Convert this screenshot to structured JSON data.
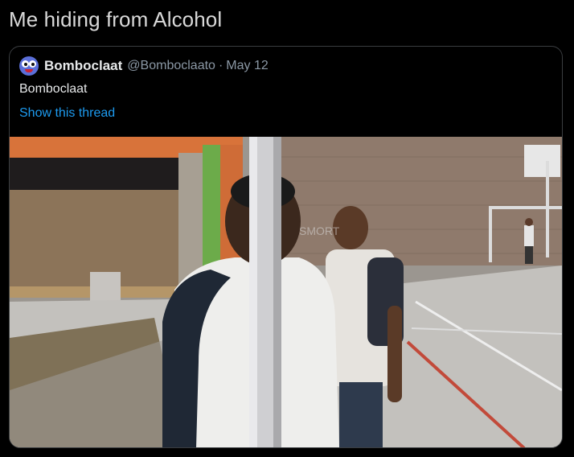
{
  "tweet": {
    "text": "Me hiding from Alcohol"
  },
  "quoted_tweet": {
    "display_name": "Bomboclaat",
    "handle": "@Bomboclaato",
    "separator": "·",
    "date": "May 12",
    "text": "Bomboclaat",
    "show_thread_label": "Show this thread",
    "avatar_icon": "cartoon-face-avatar",
    "media": {
      "type": "photo",
      "watermark": "SMORT"
    }
  },
  "colors": {
    "background": "#000000",
    "primary_text": "#e7e9ea",
    "secondary_text": "#8b98a5",
    "link": "#1d9bf0",
    "border": "#3a3d40"
  }
}
